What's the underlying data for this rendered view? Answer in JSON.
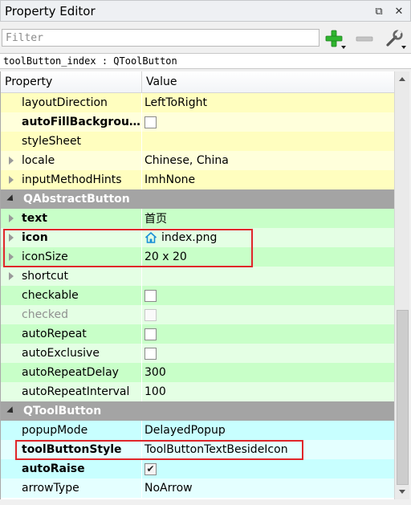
{
  "panel": {
    "title": "Property Editor",
    "float_glyph": "⧉",
    "close_glyph": "✕"
  },
  "toolbar": {
    "filter_placeholder": "Filter",
    "add_icon": "plus-icon",
    "remove_icon": "minus-icon",
    "configure_icon": "wrench-icon",
    "add_color": "#2fb52f",
    "remove_color": "#bfbfbf"
  },
  "object_line": "toolButton_index : QToolButton",
  "columns": {
    "property": "Property",
    "value": "Value"
  },
  "rows_qwidget": [
    {
      "name": "layoutDirection",
      "value": "LeftToRight"
    },
    {
      "name": "autoFillBackgrou…",
      "checked": false
    },
    {
      "name": "styleSheet",
      "value": ""
    },
    {
      "name": "locale",
      "value": "Chinese, China"
    },
    {
      "name": "inputMethodHints",
      "value": "ImhNone"
    }
  ],
  "group_abstract": "QAbstractButton",
  "rows_abstract": [
    {
      "name": "text",
      "value": "首页"
    },
    {
      "name": "icon",
      "value": "index.png"
    },
    {
      "name": "iconSize",
      "value": "20 x 20"
    },
    {
      "name": "shortcut",
      "value": ""
    },
    {
      "name": "checkable",
      "checked": false
    },
    {
      "name": "checked",
      "checked": false
    },
    {
      "name": "autoRepeat",
      "checked": false
    },
    {
      "name": "autoExclusive",
      "checked": false
    },
    {
      "name": "autoRepeatDelay",
      "value": "300"
    },
    {
      "name": "autoRepeatInterval",
      "value": "100"
    }
  ],
  "group_toolbutton": "QToolButton",
  "rows_toolbutton": [
    {
      "name": "popupMode",
      "value": "DelayedPopup"
    },
    {
      "name": "toolButtonStyle",
      "value": "ToolButtonTextBesideIcon"
    },
    {
      "name": "autoRaise",
      "checked": true
    },
    {
      "name": "arrowType",
      "value": "NoArrow"
    }
  ],
  "check_glyph": "✔",
  "highlight_color": "#e0262a"
}
